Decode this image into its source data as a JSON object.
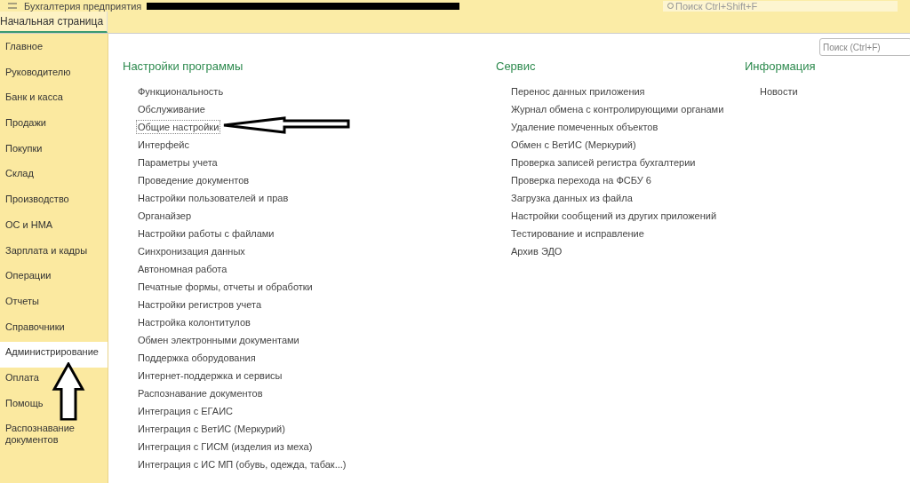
{
  "topbar": {
    "title": "Бухгалтерия предприятия",
    "global_search": {
      "placeholder": "Поиск Ctrl+Shift+F"
    }
  },
  "tabs": [
    {
      "label": "Начальная страница",
      "selected": true
    }
  ],
  "sidebar": {
    "items": [
      {
        "label": "Главное",
        "selected": false
      },
      {
        "label": "Руководителю",
        "selected": false
      },
      {
        "label": "Банк и касса",
        "selected": false
      },
      {
        "label": "Продажи",
        "selected": false
      },
      {
        "label": "Покупки",
        "selected": false
      },
      {
        "label": "Склад",
        "selected": false
      },
      {
        "label": "Производство",
        "selected": false
      },
      {
        "label": "ОС и НМА",
        "selected": false
      },
      {
        "label": "Зарплата и кадры",
        "selected": false
      },
      {
        "label": "Операции",
        "selected": false
      },
      {
        "label": "Отчеты",
        "selected": false
      },
      {
        "label": "Справочники",
        "selected": false
      },
      {
        "label": "Администрирование",
        "selected": true
      },
      {
        "label": "Оплата",
        "selected": false
      },
      {
        "label": "Помощь",
        "selected": false
      },
      {
        "label": "Распознавание документов",
        "selected": false
      }
    ]
  },
  "search": {
    "placeholder": "Поиск (Ctrl+F)"
  },
  "sections": [
    {
      "title": "Настройки программы",
      "items": [
        {
          "label": "Функциональность",
          "focused": false
        },
        {
          "label": "Обслуживание",
          "focused": false
        },
        {
          "label": "Общие настройки",
          "focused": true
        },
        {
          "label": "Интерфейс",
          "focused": false
        },
        {
          "label": "Параметры учета",
          "focused": false
        },
        {
          "label": "Проведение документов",
          "focused": false
        },
        {
          "label": "Настройки пользователей и прав",
          "focused": false
        },
        {
          "label": "Органайзер",
          "focused": false
        },
        {
          "label": "Настройки работы с файлами",
          "focused": false
        },
        {
          "label": "Синхронизация данных",
          "focused": false
        },
        {
          "label": "Автономная работа",
          "focused": false
        },
        {
          "label": "Печатные формы, отчеты и обработки",
          "focused": false
        },
        {
          "label": "Настройки регистров учета",
          "focused": false
        },
        {
          "label": "Настройка колонтитулов",
          "focused": false
        },
        {
          "label": "Обмен электронными документами",
          "focused": false
        },
        {
          "label": "Поддержка оборудования",
          "focused": false
        },
        {
          "label": "Интернет-поддержка и сервисы",
          "focused": false
        },
        {
          "label": "Распознавание документов",
          "focused": false
        },
        {
          "label": "Интеграция с ЕГАИС",
          "focused": false
        },
        {
          "label": "Интеграция с ВетИС (Меркурий)",
          "focused": false
        },
        {
          "label": "Интеграция с ГИСМ (изделия из меха)",
          "focused": false
        },
        {
          "label": "Интеграция с ИС МП (обувь, одежда, табак...)",
          "focused": false
        }
      ]
    },
    {
      "title": "Сервис",
      "items": [
        {
          "label": "Перенос данных приложения",
          "focused": false
        },
        {
          "label": "Журнал обмена с контролирующими органами",
          "focused": false
        },
        {
          "label": "Удаление помеченных объектов",
          "focused": false
        },
        {
          "label": "Обмен с ВетИС (Меркурий)",
          "focused": false
        },
        {
          "label": "Проверка записей регистра бухгалтерии",
          "focused": false
        },
        {
          "label": "Проверка перехода на ФСБУ 6",
          "focused": false
        },
        {
          "label": "Загрузка данных из файла",
          "focused": false
        },
        {
          "label": "Настройки сообщений из других приложений",
          "focused": false
        },
        {
          "label": "Тестирование и исправление",
          "focused": false
        },
        {
          "label": "Архив ЭДО",
          "focused": false
        }
      ]
    },
    {
      "title": "Информация",
      "items": [
        {
          "label": "Новости",
          "focused": false
        }
      ]
    }
  ]
}
